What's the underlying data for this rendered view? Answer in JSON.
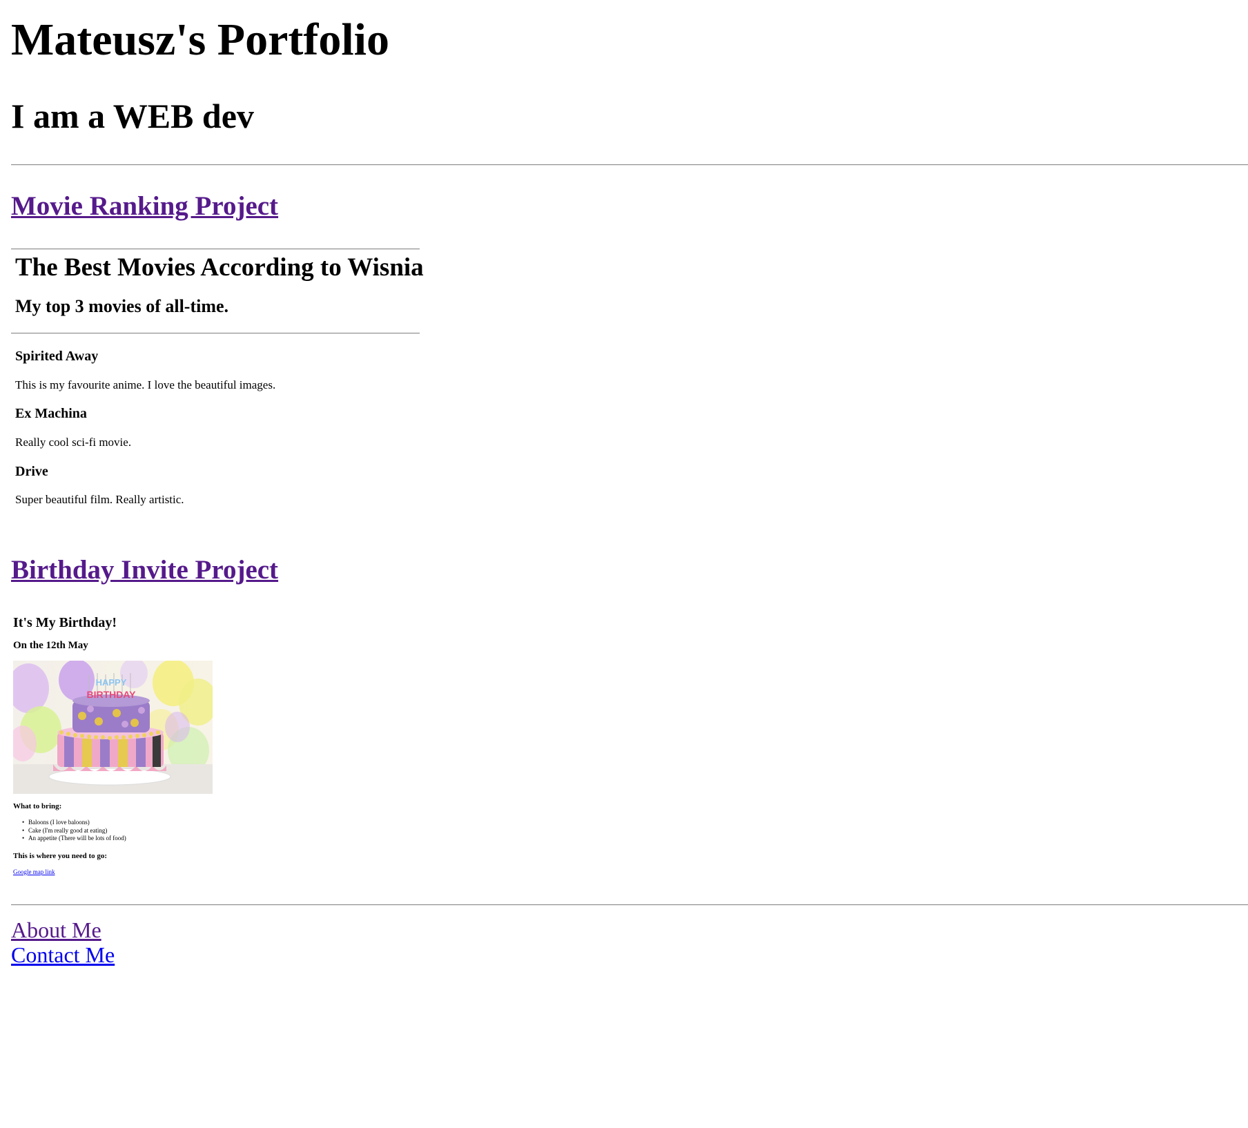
{
  "header": {
    "title": "Mateusz's Portfolio",
    "subtitle": "I am a WEB dev"
  },
  "projects": {
    "movie": {
      "link_label": "Movie Ranking Project",
      "page_title": "The Best Movies According to Wisnia",
      "page_subtitle": "My top 3 movies of all-time.",
      "movies": [
        {
          "name": "Spirited Away",
          "description": "This is my favourite anime. I love the beautiful images."
        },
        {
          "name": "Ex Machina",
          "description": "Really cool sci-fi movie."
        },
        {
          "name": "Drive",
          "description": "Super beautiful film. Really artistic."
        }
      ]
    },
    "birthday": {
      "link_label": "Birthday Invite Project",
      "title": "It's My Birthday!",
      "date": "On the 12th May",
      "cake_text": "HAPPY BIRTHDAY",
      "bring_heading": "What to bring:",
      "bring_items": [
        "Baloons (I love baloons)",
        "Cake (I'm really good at eating)",
        "An appetite (There will be lots of food)"
      ],
      "location_heading": "This is where you need to go:",
      "map_link_label": "Google map link"
    }
  },
  "footer": {
    "about_label": "About Me",
    "contact_label": "Contact Me"
  },
  "colors": {
    "visited_link": "#551a8b",
    "unvisited_link": "#0000ee",
    "text": "#000000",
    "background": "#ffffff"
  }
}
